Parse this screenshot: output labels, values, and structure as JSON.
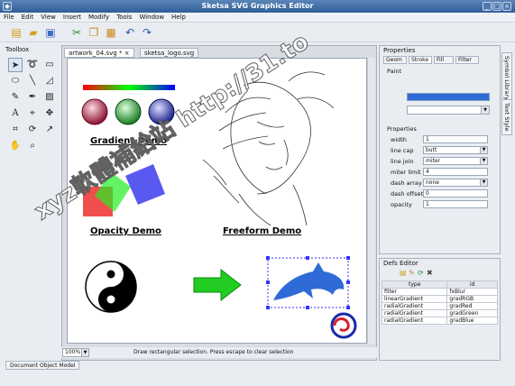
{
  "window": {
    "title": "Sketsa SVG Graphics Editor",
    "buttons": [
      "_",
      "□",
      "×"
    ]
  },
  "menu": [
    "File",
    "Edit",
    "View",
    "Insert",
    "Modify",
    "Tools",
    "Window",
    "Help"
  ],
  "toolbox": {
    "title": "Toolbox"
  },
  "tabs": [
    "artwork_04.svg *",
    "sketsa_logo.svg"
  ],
  "canvas": {
    "labels": {
      "gradient": "Gradient Demo",
      "opacity": "Opacity Demo",
      "freeform": "Freeform Demo"
    },
    "colors": {
      "red": "#b02244",
      "green": "#2e9a3a",
      "blue": "#3a44c4",
      "dolphin": "#2f6bd6",
      "arrow": "#22cc22"
    }
  },
  "zoom": "100%",
  "status": "Draw rectangular selection. Press escape to clear selection",
  "bottom_tab": "Document Object Model",
  "properties": {
    "title": "Properties",
    "tabs": [
      "Geom",
      "Stroke",
      "Fill",
      "Filter"
    ],
    "paint_label": "Paint",
    "section": "Properties",
    "rows": [
      {
        "label": "width",
        "value": "1"
      },
      {
        "label": "line cap",
        "value": "butt"
      },
      {
        "label": "line join",
        "value": "miter"
      },
      {
        "label": "miter limit",
        "value": "4"
      },
      {
        "label": "dash array",
        "value": "none"
      },
      {
        "label": "dash offset",
        "value": "0"
      },
      {
        "label": "opacity",
        "value": "1"
      }
    ]
  },
  "side_tabs": [
    "Symbol Library",
    "Text Style"
  ],
  "defs": {
    "title": "Defs Editor",
    "headers": [
      "type",
      "id"
    ],
    "rows": [
      [
        "filter",
        "fxBlur"
      ],
      [
        "linearGradient",
        "gradRGB"
      ],
      [
        "radialGradient",
        "gradRed"
      ],
      [
        "radialGradient",
        "gradGreen"
      ],
      [
        "radialGradient",
        "gradBlue"
      ]
    ]
  },
  "watermark": "xyz軟體補給站 http://31.to"
}
